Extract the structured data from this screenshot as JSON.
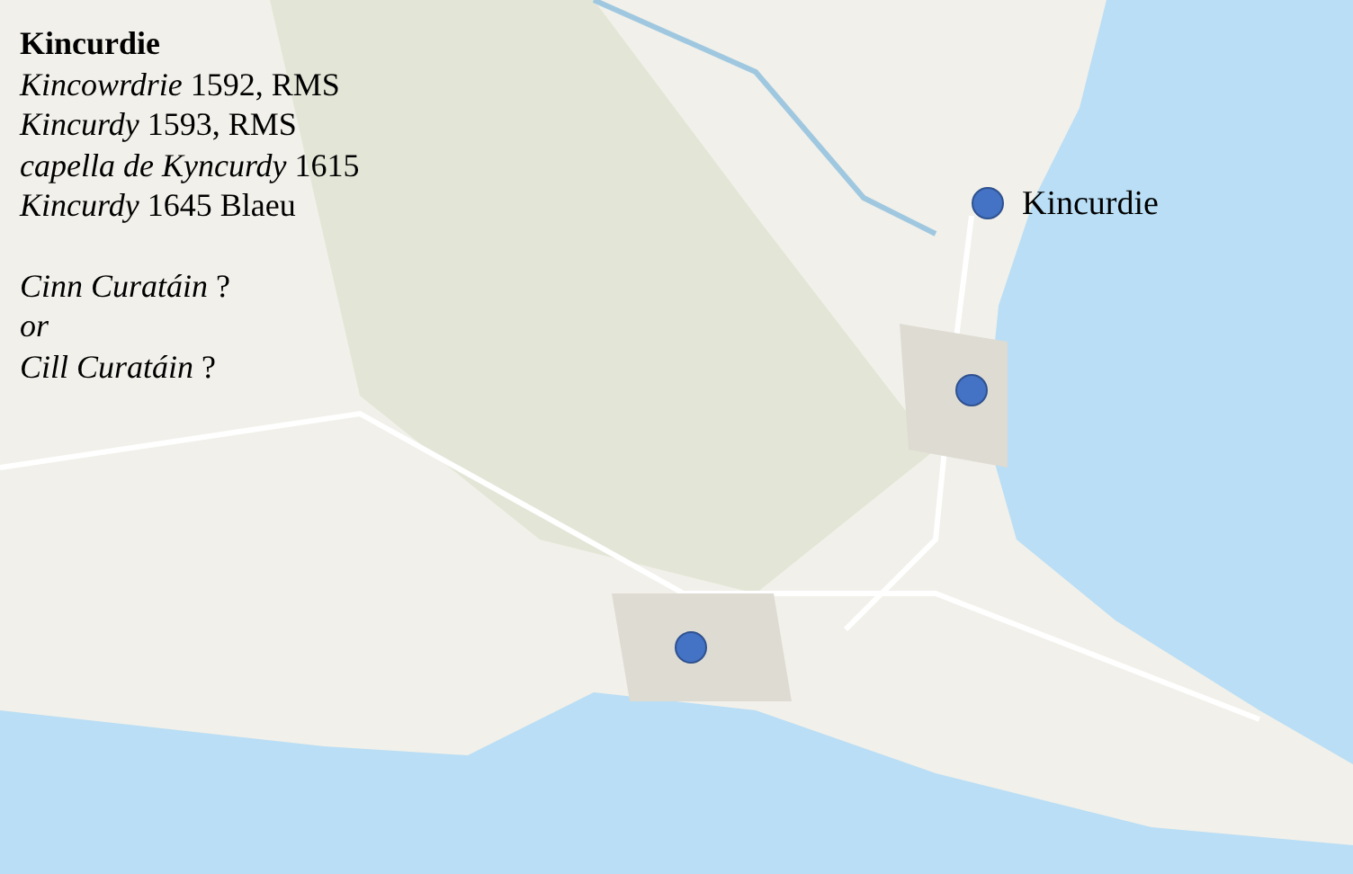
{
  "title": "Kincurdie",
  "lines": [
    {
      "text": "*Kincowrdrie* 1592, RMS",
      "italic": false
    },
    {
      "text": "*Kincurdy* 1593, RMS",
      "italic": false
    },
    {
      "text": "*capella de Kyncurdy* 1615",
      "italic": false
    },
    {
      "text": "*Kincurdy* 1645 Blaeu",
      "italic": false
    }
  ],
  "gaelic": [
    {
      "text": "*Cinn Curatáin* ?",
      "italic": false
    },
    {
      "text": "or",
      "italic": true
    },
    {
      "text": "*Cill Curatáin* ?",
      "italic": false
    }
  ],
  "marker_label": "Kincurdie"
}
